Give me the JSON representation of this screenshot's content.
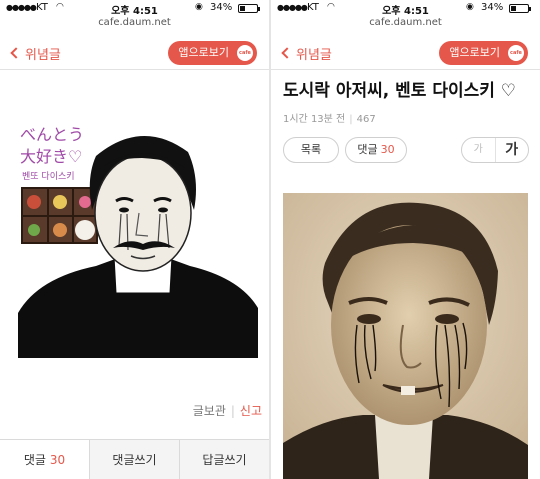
{
  "status_bar": {
    "signal": "●●●●●",
    "carrier": "KT",
    "time": "오후 4:51",
    "battery_text": "34%",
    "battery_level": 0.34
  },
  "browser": {
    "url": "cafe.daum.net"
  },
  "header": {
    "back_label": "위념글",
    "app_button_label": "앱으로보기",
    "app_badge": "cafe",
    "accent_color": "#e5574a"
  },
  "left": {
    "image_caption": {
      "line1": "べんとう",
      "line2": "大好き♡",
      "line3": "벤또 다이스키"
    },
    "actions": {
      "view_source": "글보관",
      "report": "신고"
    },
    "tabs": [
      {
        "label": "댓글",
        "count": "30"
      },
      {
        "label": "댓글쓰기"
      },
      {
        "label": "답글쓰기"
      }
    ]
  },
  "right": {
    "title": "도시락 아저씨, 벤토 다이스키 ♡",
    "meta": {
      "time_ago": "1시간 13분 전",
      "views": "467"
    },
    "list_button": "목록",
    "comment_button": {
      "label": "댓글",
      "count": "30"
    },
    "font_small": "가",
    "font_large": "가"
  }
}
